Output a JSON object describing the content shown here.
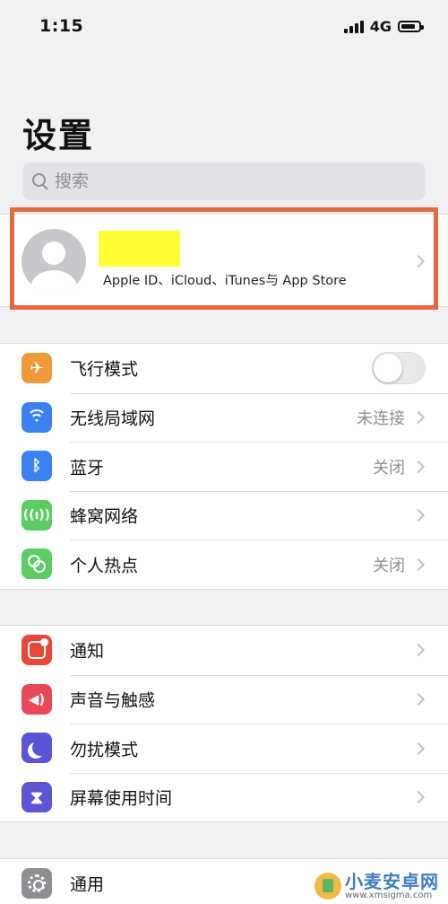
{
  "status_bar": {
    "time": "1:15",
    "network": "4G"
  },
  "page": {
    "title": "设置"
  },
  "search": {
    "placeholder": "搜索"
  },
  "profile": {
    "subtitle": "Apple ID、iCloud、iTunes与 App Store"
  },
  "colors": {
    "highlight_border": "#e8683d",
    "redaction": "#ffff33",
    "airplane": "#f19a38",
    "wifi": "#3b82f0",
    "bluetooth": "#3b82f0",
    "cellular": "#5ccc64",
    "hotspot": "#5ccc64",
    "notifications": "#e8483c",
    "sounds": "#e8485a",
    "do_not_disturb": "#5b55d6",
    "screen_time": "#5b55d6",
    "general": "#8e8e93"
  },
  "group1": {
    "items": [
      {
        "label": "飞行模式",
        "icon": "airplane-icon",
        "toggle": "off"
      },
      {
        "label": "无线局域网",
        "icon": "wifi-icon",
        "value": "未连接"
      },
      {
        "label": "蓝牙",
        "icon": "bluetooth-icon",
        "value": "关闭"
      },
      {
        "label": "蜂窝网络",
        "icon": "cellular-icon"
      },
      {
        "label": "个人热点",
        "icon": "hotspot-icon",
        "value": "关闭"
      }
    ]
  },
  "group2": {
    "items": [
      {
        "label": "通知",
        "icon": "notifications-icon"
      },
      {
        "label": "声音与触感",
        "icon": "sounds-icon"
      },
      {
        "label": "勿扰模式",
        "icon": "moon-icon"
      },
      {
        "label": "屏幕使用时间",
        "icon": "hourglass-icon"
      }
    ]
  },
  "group3": {
    "items": [
      {
        "label": "通用",
        "icon": "gear-icon"
      }
    ]
  },
  "watermark": {
    "title": "小麦安卓网",
    "url": "www.xmsigma.com"
  }
}
